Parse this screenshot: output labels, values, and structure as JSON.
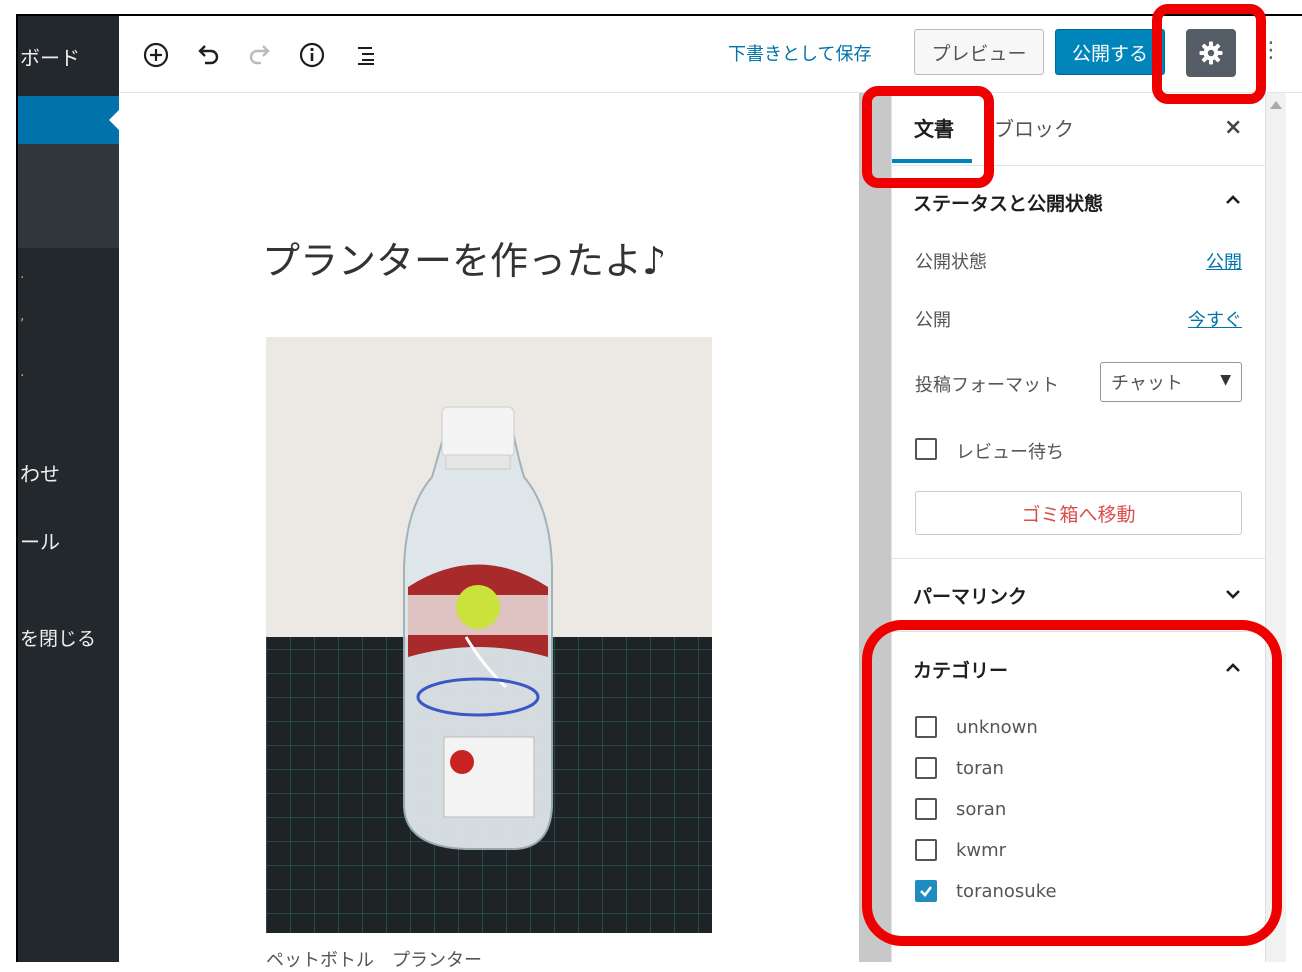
{
  "sidebar": {
    "dashboard_label": "ボード",
    "item_contact": "わせ",
    "item_tools": "ール",
    "collapse_menu": "を閉じる"
  },
  "toolbar": {
    "save_draft": "下書きとして保存",
    "preview": "プレビュー",
    "publish": "公開する",
    "add_icon": "add-block-icon",
    "undo_icon": "undo-icon",
    "redo_icon": "redo-icon",
    "info_icon": "info-icon",
    "outline_icon": "outline-icon",
    "settings_icon": "gear-icon"
  },
  "editor": {
    "post_title": "プランターを作ったよ♪",
    "caption": "ペットボトル　プランター"
  },
  "panel": {
    "tab_document": "文書",
    "tab_block": "ブロック",
    "close": "×",
    "status_section": {
      "title": "ステータスと公開状態",
      "visibility_label": "公開状態",
      "visibility_value": "公開",
      "publish_label": "公開",
      "publish_value": "今すぐ",
      "format_label": "投稿フォーマット",
      "format_selected": "チャット",
      "pending_review_label": "レビュー待ち",
      "pending_review_checked": false,
      "trash_button": "ゴミ箱へ移動"
    },
    "permalink_section": {
      "title": "パーマリンク"
    },
    "category_section": {
      "title": "カテゴリー",
      "items": [
        {
          "label": "unknown",
          "checked": false
        },
        {
          "label": "toran",
          "checked": false
        },
        {
          "label": "soran",
          "checked": false
        },
        {
          "label": "kwmr",
          "checked": false
        },
        {
          "label": "toranosuke",
          "checked": true
        }
      ]
    }
  },
  "colors": {
    "accent": "#0085ba",
    "sidebar_bg": "#23282d",
    "highlight": "#ee0000",
    "trash_text": "#d94f4f"
  }
}
